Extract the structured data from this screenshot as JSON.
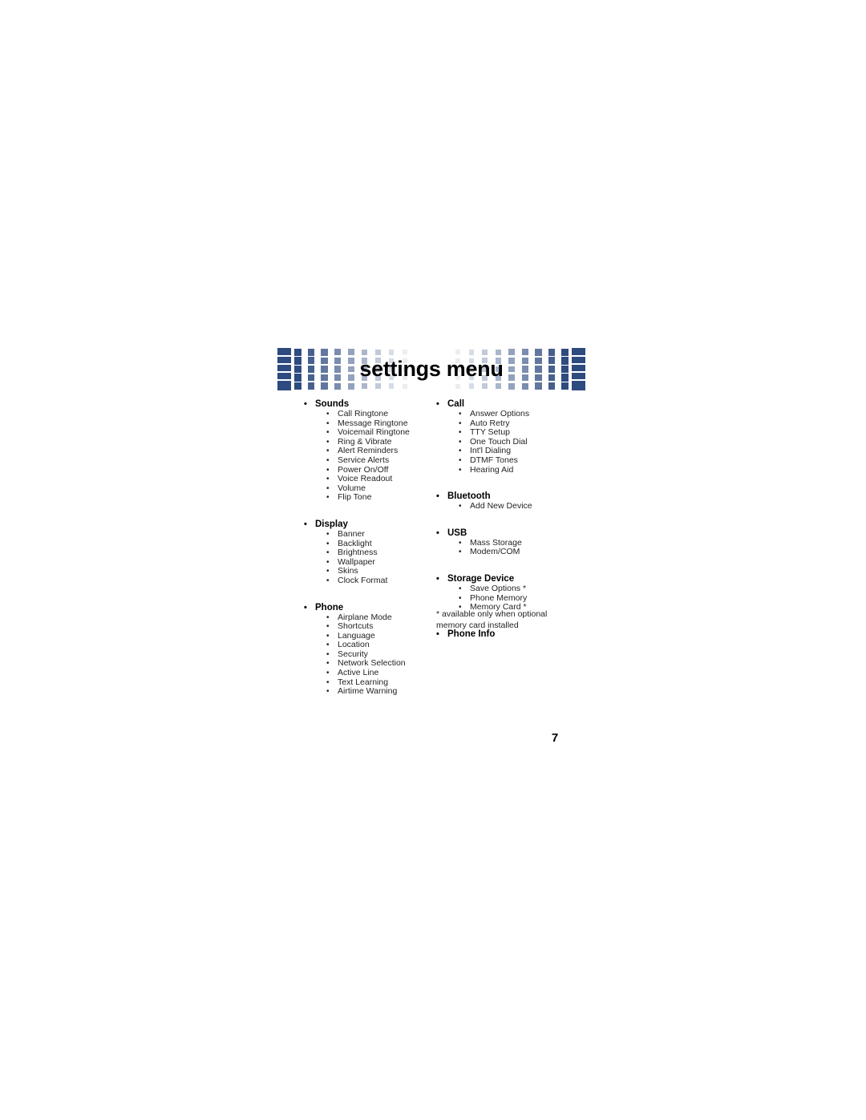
{
  "page": {
    "title": "settings menu",
    "number": "7",
    "footnote": "* available only when optional memory card installed",
    "banner_color": "#2e4b7f",
    "text_color": "#231f20"
  },
  "columns": [
    {
      "id": "left",
      "groups": [
        {
          "label": "Sounds",
          "items": [
            "Call Ringtone",
            "Message Ringtone",
            "Voicemail Ringtone",
            "Ring & Vibrate",
            "Alert Reminders",
            "Service Alerts",
            "Power On/Off",
            "Voice Readout",
            "Volume",
            "Flip Tone"
          ]
        },
        {
          "label": "Display",
          "items": [
            "Banner",
            "Backlight",
            "Brightness",
            "Wallpaper",
            "Skins",
            "Clock Format"
          ]
        },
        {
          "label": "Phone",
          "items": [
            "Airplane Mode",
            "Shortcuts",
            "Language",
            "Location",
            "Security",
            "Network Selection",
            "Active Line",
            "Text Learning",
            "Airtime Warning"
          ]
        }
      ]
    },
    {
      "id": "right",
      "groups": [
        {
          "label": "Call",
          "items": [
            "Answer Options",
            "Auto Retry",
            "TTY Setup",
            "One Touch Dial",
            "Int'l Dialing",
            "DTMF Tones",
            "Hearing Aid"
          ]
        },
        {
          "label": "Bluetooth",
          "items": [
            "Add New Device"
          ]
        },
        {
          "label": "USB",
          "items": [
            "Mass Storage",
            "Modem/COM"
          ]
        },
        {
          "label": "Storage Device",
          "items": [
            "Save Options *",
            "Phone Memory",
            "Memory Card *"
          ]
        },
        {
          "label": "Phone Info",
          "items": []
        }
      ]
    }
  ],
  "bullets": {
    "level1": "•",
    "level2": "•"
  }
}
